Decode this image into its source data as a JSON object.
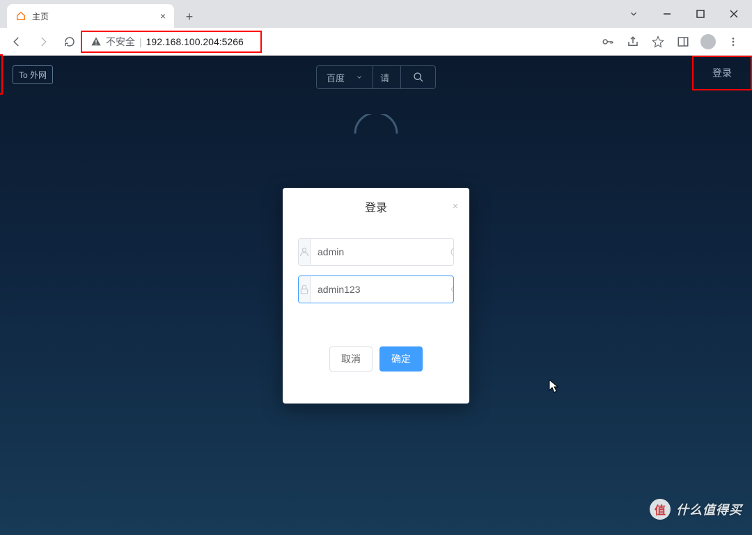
{
  "browser": {
    "tab_title": "主页",
    "security_label": "不安全",
    "url": "192.168.100.204:5266"
  },
  "page": {
    "to_external_label": "To 外网",
    "search_engine": "百度",
    "search_placeholder": "请",
    "login_link": "登录"
  },
  "modal": {
    "title": "登录",
    "username_value": "admin",
    "password_value": "admin123",
    "cancel_label": "取消",
    "confirm_label": "确定"
  },
  "watermark": {
    "badge": "值",
    "text": "什么值得买"
  }
}
